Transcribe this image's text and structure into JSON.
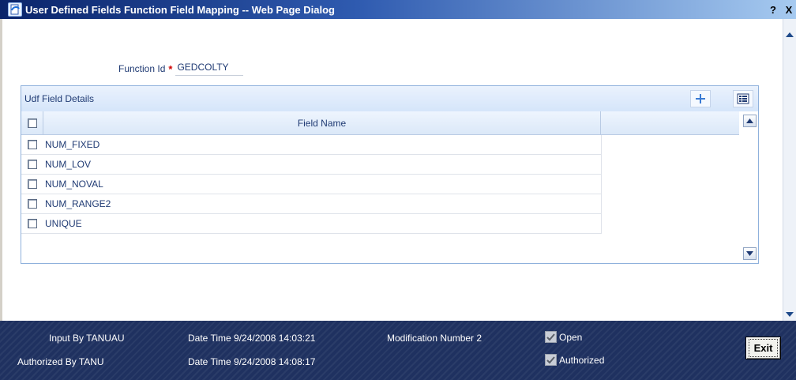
{
  "window": {
    "title": "User Defined Fields Function Field Mapping -- Web Page Dialog",
    "help_label": "?",
    "close_label": "X"
  },
  "function": {
    "label": "Function Id",
    "required_mark": "*",
    "value": "GEDCOLTY"
  },
  "udf_panel": {
    "title": "Udf Field Details",
    "column_header": "Field Name",
    "rows": [
      {
        "name": "NUM_FIXED",
        "checked": false
      },
      {
        "name": "NUM_LOV",
        "checked": false
      },
      {
        "name": "NUM_NOVAL",
        "checked": false
      },
      {
        "name": "NUM_RANGE2",
        "checked": false
      },
      {
        "name": "UNIQUE",
        "checked": false
      }
    ]
  },
  "footer": {
    "input_by": "Input By TANUAU",
    "authorized_by": "Authorized By TANU",
    "date_time_input": "Date Time 9/24/2008 14:03:21",
    "date_time_auth": "Date Time 9/24/2008 14:08:17",
    "modification": "Modification Number 2",
    "open_label": "Open",
    "open_checked": true,
    "authorized_label": "Authorized",
    "authorized_checked": true,
    "exit_label": "Exit"
  },
  "colors": {
    "footer_bg": "#1f3160",
    "text": "#1f3a73",
    "required": "#d00000"
  }
}
